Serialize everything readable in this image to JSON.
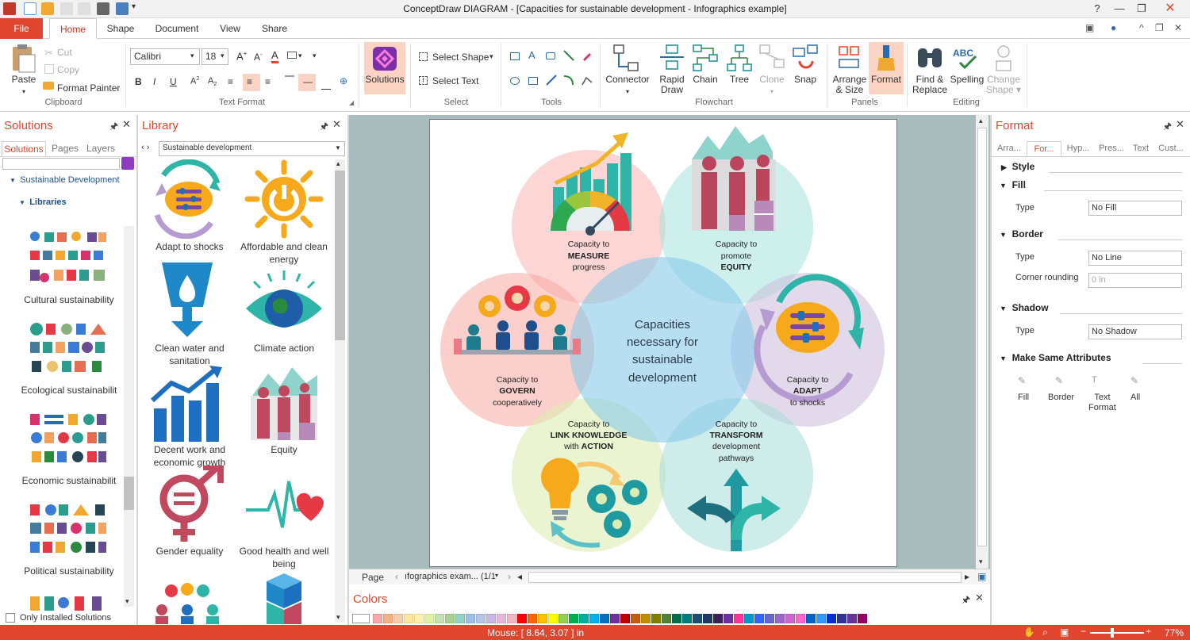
{
  "window": {
    "title": "ConceptDraw DIAGRAM - [Capacities for sustainable development - Infographics example]"
  },
  "ribbon_tabs": [
    "File",
    "Home",
    "Shape",
    "Document",
    "View",
    "Share"
  ],
  "ribbon": {
    "clipboard": {
      "paste": "Paste",
      "cut": "Cut",
      "copy": "Copy",
      "format_painter": "Format Painter",
      "label": "Clipboard"
    },
    "text_format": {
      "font": "Calibri",
      "size": "18",
      "label": "Text Format"
    },
    "solutions": {
      "label": "Solutions"
    },
    "select": {
      "select_shape": "Select Shape",
      "select_text": "Select Text",
      "label": "Select"
    },
    "tools": {
      "label": "Tools"
    },
    "flowchart": {
      "connector": "Connector",
      "rapid_draw_1": "Rapid",
      "rapid_draw_2": "Draw",
      "chain": "Chain",
      "tree": "Tree",
      "clone": "Clone",
      "snap": "Snap",
      "label": "Flowchart"
    },
    "panels": {
      "arrange_1": "Arrange",
      "arrange_2": "& Size",
      "format": "Format",
      "label": "Panels"
    },
    "editing": {
      "find_1": "Find &",
      "find_2": "Replace",
      "spelling": "Spelling",
      "change_1": "Change",
      "change_2": "Shape",
      "label": "Editing"
    }
  },
  "solutions_panel": {
    "title": "Solutions",
    "tabs": [
      "Solutions",
      "Pages",
      "Layers"
    ],
    "tree": {
      "root": "Sustainable Development",
      "child": "Libraries"
    },
    "libraries": [
      "Cultural sustainability",
      "Ecological sustainabilit",
      "Economic sustainabilit",
      "Political sustainability"
    ],
    "only_installed": "Only Installed Solutions"
  },
  "library_panel": {
    "title": "Library",
    "selected": "Sustainable development",
    "items": [
      {
        "label": "Adapt to shocks",
        "icon": "brain-adapt-icon"
      },
      {
        "label": "Affordable and clean energy",
        "icon": "sun-power-icon"
      },
      {
        "label": "Clean water and sanitation",
        "icon": "water-glass-icon"
      },
      {
        "label": "Climate action",
        "icon": "eye-globe-icon"
      },
      {
        "label": "Decent work and economic growth",
        "icon": "growth-chart-icon"
      },
      {
        "label": "Equity",
        "icon": "equity-people-icon"
      },
      {
        "label": "Gender equality",
        "icon": "gender-equality-icon"
      },
      {
        "label": "Good health and well being",
        "icon": "heartbeat-icon"
      }
    ]
  },
  "diagram": {
    "center": [
      "Capacities",
      "necessary for",
      "sustainable",
      "development"
    ],
    "measure": {
      "line1": "Capacity to",
      "bold": "MEASURE",
      "line3": "progress"
    },
    "equity": {
      "line1": "Capacity to",
      "line2": "promote",
      "bold": "EQUITY"
    },
    "govern": {
      "line1": "Capacity to",
      "bold": "GOVERN",
      "line3": "cooperatively"
    },
    "adapt": {
      "line1": "Capacity to",
      "bold": "ADAPT",
      "line3": "to shocks"
    },
    "link": {
      "line1": "Capacity to",
      "bold": "LINK KNOWLEDGE",
      "line3_pre": "with ",
      "line3_bold": "ACTION"
    },
    "transform": {
      "line1": "Capacity to",
      "bold": "TRANSFORM",
      "line3": "development",
      "line4": "pathways"
    }
  },
  "page_nav": {
    "label": "Page",
    "page_name": "ıfographics exam... (1/1"
  },
  "colors_panel": {
    "title": "Colors",
    "swatches": [
      "#f7a8a8",
      "#f4b183",
      "#f8cbad",
      "#ffe699",
      "#fff2a8",
      "#e2f0a8",
      "#c6e0b4",
      "#a9d08e",
      "#92d2c6",
      "#9bc2e6",
      "#b4c7e7",
      "#c9b8e6",
      "#e6b8d8",
      "#f4b6c2",
      "#ff0000",
      "#ff6600",
      "#ffc000",
      "#ffff00",
      "#92d050",
      "#00b050",
      "#00b0a0",
      "#00b0f0",
      "#0070c0",
      "#7030a0",
      "#c00000",
      "#c55a11",
      "#bf9000",
      "#7f7f00",
      "#548235",
      "#00704a",
      "#008080",
      "#1f4e79",
      "#203864",
      "#3a1f5d",
      "#7030a0",
      "#ff3399",
      "#0099cc",
      "#3366ff",
      "#6666cc",
      "#9966cc",
      "#cc66cc",
      "#ff66cc",
      "#0066cc",
      "#3399ff",
      "#0033cc",
      "#333399",
      "#663399",
      "#990066"
    ]
  },
  "format_panel": {
    "title": "Format",
    "tabs": [
      "Arra...",
      "For...",
      "Hyp...",
      "Pres...",
      "Text",
      "Cust..."
    ],
    "style": "Style",
    "fill": {
      "title": "Fill",
      "type_label": "Type",
      "type_value": "No Fill"
    },
    "border": {
      "title": "Border",
      "type_label": "Type",
      "type_value": "No Line",
      "corner_label": "Corner rounding",
      "corner_value": "0 in"
    },
    "shadow": {
      "title": "Shadow",
      "type_label": "Type",
      "type_value": "No Shadow"
    },
    "make_same": {
      "title": "Make Same Attributes",
      "fill": "Fill",
      "border": "Border",
      "text_1": "Text",
      "text_2": "Format",
      "all": "All"
    }
  },
  "status": {
    "mouse": "Mouse: [ 8.64, 3.07 ] in",
    "zoom": "77%"
  }
}
